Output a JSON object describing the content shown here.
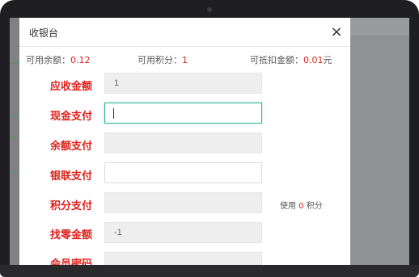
{
  "modal": {
    "title": "收银台",
    "close_glyph": "×"
  },
  "info": {
    "balance_label": "可用余额：",
    "balance_value": "0.12",
    "points_label": "可用积分：",
    "points_value": "1",
    "deduct_label": "可抵扣金额：",
    "deduct_value": "0.01",
    "deduct_unit": "元"
  },
  "form": {
    "receivable_label": "应收金额",
    "receivable_value": "1",
    "cash_label": "现金支付",
    "cash_value": "",
    "balance_pay_label": "余额支付",
    "balance_pay_value": "",
    "unionpay_label": "银联支付",
    "unionpay_value": "",
    "points_pay_label": "积分支付",
    "points_pay_value": "",
    "points_use_prefix": "使用",
    "points_use_value": "0",
    "points_use_suffix": "积分",
    "change_label": "找零金额",
    "change_value": "-1",
    "member_password_label": "会员密码",
    "member_password_value": ""
  },
  "colors": {
    "label_red": "#e0211b",
    "value_red": "#e02020",
    "focus_green": "#2fb79a",
    "disabled_bg": "#eeeeee"
  },
  "icons": {
    "close": "close-icon"
  }
}
